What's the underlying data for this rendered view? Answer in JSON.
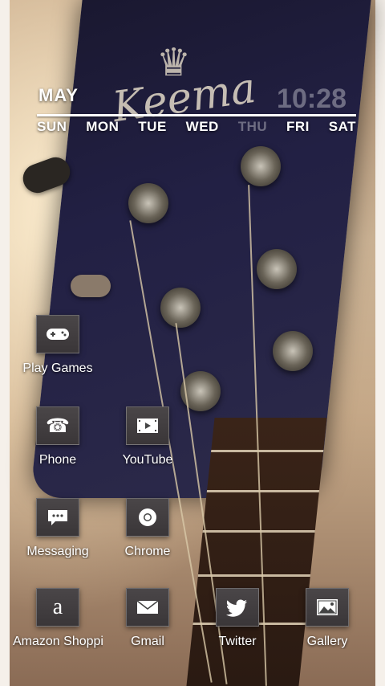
{
  "calendar": {
    "month": "MAY",
    "time": "10:28",
    "days": [
      "SUN",
      "MON",
      "TUE",
      "WED",
      "THU",
      "FRI",
      "SAT"
    ],
    "today_index": 4
  },
  "wallpaper": {
    "brand_text": "Keema"
  },
  "apps": [
    {
      "label": "Play Games",
      "icon": "gamepad-icon"
    },
    {
      "label": "Phone",
      "icon": "phone-icon"
    },
    {
      "label": "YouTube",
      "icon": "youtube-icon"
    },
    {
      "label": "Messaging",
      "icon": "message-icon"
    },
    {
      "label": "Chrome",
      "icon": "chrome-icon"
    },
    {
      "label": "Amazon Shoppi",
      "icon": "amazon-icon"
    },
    {
      "label": "Gmail",
      "icon": "mail-icon"
    },
    {
      "label": "Twitter",
      "icon": "twitter-icon"
    },
    {
      "label": "Gallery",
      "icon": "gallery-icon"
    }
  ]
}
